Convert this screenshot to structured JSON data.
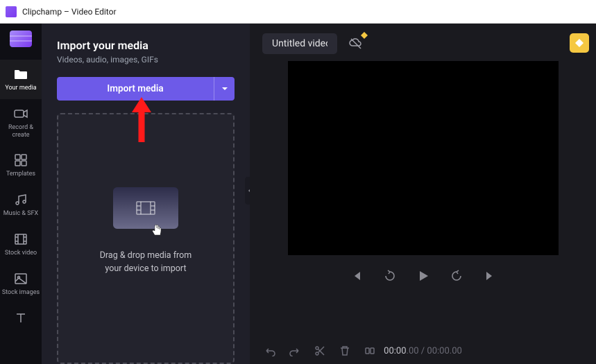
{
  "app": {
    "title": "Clipchamp – Video Editor"
  },
  "sidebar": {
    "items": [
      {
        "label": "Your media"
      },
      {
        "label": "Record & create"
      },
      {
        "label": "Templates"
      },
      {
        "label": "Music & SFX"
      },
      {
        "label": "Stock video"
      },
      {
        "label": "Stock images"
      }
    ]
  },
  "panel": {
    "title": "Import your media",
    "subtitle": "Videos, audio, images, GIFs",
    "importButton": "Import media",
    "dropzoneText1": "Drag & drop media from",
    "dropzoneText2": "your device to import"
  },
  "header": {
    "videoTitle": "Untitled video"
  },
  "timeline": {
    "current": "00:00",
    "currentFrac": ".00",
    "sep": " / ",
    "total": "00:00",
    "totalFrac": ".00"
  },
  "colors": {
    "accent": "#6d5ae8"
  }
}
